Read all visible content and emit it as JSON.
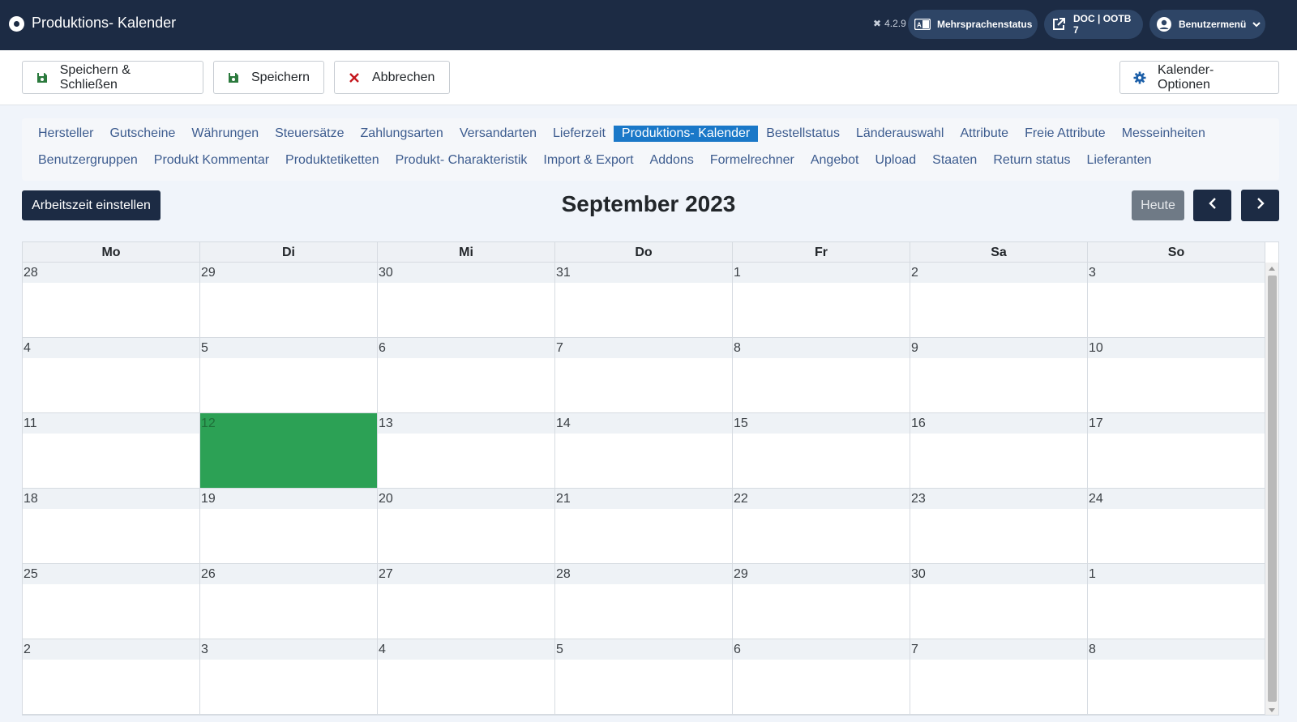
{
  "header": {
    "title": "Produktions- Kalender",
    "version": "4.2.9",
    "pills": [
      {
        "label": "Mehrsprachenstatus",
        "icon": "language-icon"
      },
      {
        "label": "DOC | OOTB 7",
        "icon": "external-link-icon"
      },
      {
        "label": "Benutzermenü",
        "icon": "user-icon"
      }
    ]
  },
  "toolbar": {
    "save_close": "Speichern & Schließen",
    "save": "Speichern",
    "cancel": "Abbrechen",
    "options": "Kalender-Optionen"
  },
  "nav": {
    "row1": [
      "Hersteller",
      "Gutscheine",
      "Währungen",
      "Steuersätze",
      "Zahlungsarten",
      "Versandarten",
      "Lieferzeit",
      "Produktions- Kalender",
      "Bestellstatus",
      "Länderauswahl",
      "Attribute",
      "Freie Attribute",
      "Messeinheiten"
    ],
    "row2": [
      "Benutzergruppen",
      "Produkt Kommentar",
      "Produktetiketten",
      "Produkt- Charakteristik",
      "Import & Export",
      "Addons",
      "Formelrechner",
      "Angebot",
      "Upload",
      "Staaten",
      "Return status",
      "Lieferanten"
    ],
    "active": "Produktions- Kalender"
  },
  "calendar": {
    "working_time_button": "Arbeitszeit einstellen",
    "month_title": "September 2023",
    "today_button": "Heute",
    "weekdays": [
      "Mo",
      "Di",
      "Mi",
      "Do",
      "Fr",
      "Sa",
      "So"
    ],
    "weeks": [
      [
        "28",
        "29",
        "30",
        "31",
        "1",
        "2",
        "3"
      ],
      [
        "4",
        "5",
        "6",
        "7",
        "8",
        "9",
        "10"
      ],
      [
        "11",
        "12",
        "13",
        "14",
        "15",
        "16",
        "17"
      ],
      [
        "18",
        "19",
        "20",
        "21",
        "22",
        "23",
        "24"
      ],
      [
        "25",
        "26",
        "27",
        "28",
        "29",
        "30",
        "1"
      ],
      [
        "2",
        "3",
        "4",
        "5",
        "6",
        "7",
        "8"
      ]
    ],
    "today": {
      "week": 2,
      "day": 1
    },
    "today_color": "#2ca155"
  },
  "colors": {
    "header_bg": "#1c2b44",
    "accent": "#1a78c8",
    "link": "#3d5c8f"
  }
}
